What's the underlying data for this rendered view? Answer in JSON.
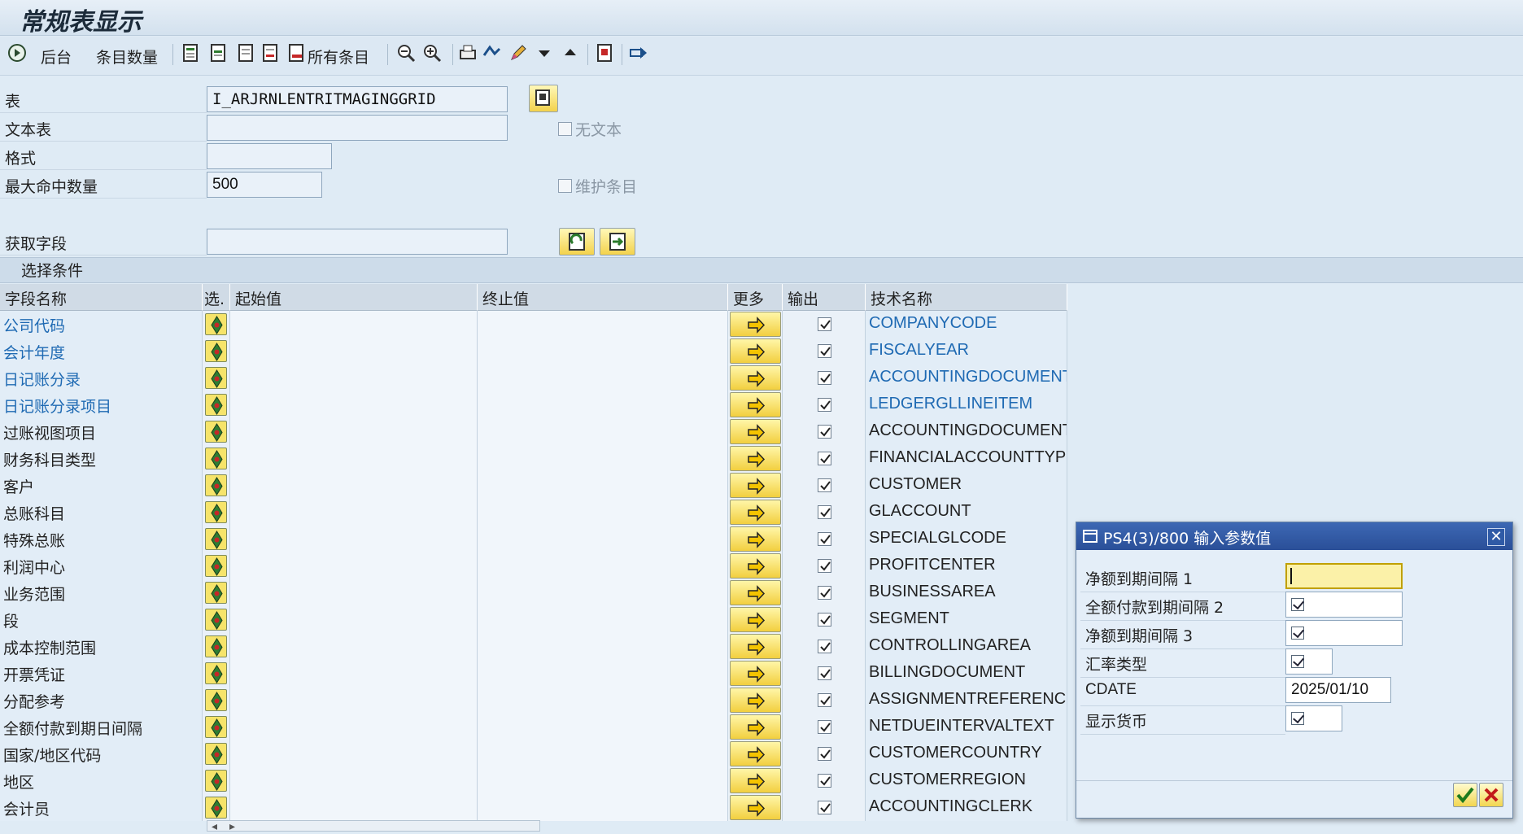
{
  "window": {
    "title": "常规表显示"
  },
  "toolbar": {
    "background_label": "后台",
    "entry_count_label": "条目数量",
    "all_entries_label": "所有条目"
  },
  "header_form": {
    "table": {
      "label": "表",
      "value": "I_ARJRNLENTRITMAGINGGRID"
    },
    "text_table": {
      "label": "文本表",
      "value": ""
    },
    "format": {
      "label": "格式",
      "value": ""
    },
    "max_hits": {
      "label": "最大命中数量",
      "value": "500"
    },
    "fetch_fields": {
      "label": "获取字段",
      "value": ""
    },
    "no_text": {
      "label": "无文本",
      "checked": false
    },
    "maintain_entries": {
      "label": "维护条目",
      "checked": false
    }
  },
  "selection": {
    "title": "选择条件",
    "columns": {
      "field_name": "字段名称",
      "select": "选.",
      "from_value": "起始值",
      "to_value": "终止值",
      "more": "更多",
      "output": "输出",
      "tech_name": "技术名称"
    },
    "rows": [
      {
        "name": "公司代码",
        "tech": "COMPANYCODE",
        "link": true
      },
      {
        "name": "会计年度",
        "tech": "FISCALYEAR",
        "link": true
      },
      {
        "name": "日记账分录",
        "tech": "ACCOUNTINGDOCUMENT",
        "link": true
      },
      {
        "name": "日记账分录项目",
        "tech": "LEDGERGLLINEITEM",
        "link": true
      },
      {
        "name": "过账视图项目",
        "tech": "ACCOUNTINGDOCUMENTI...",
        "link": false
      },
      {
        "name": "财务科目类型",
        "tech": "FINANCIALACCOUNTTYPE",
        "link": false
      },
      {
        "name": "客户",
        "tech": "CUSTOMER",
        "link": false
      },
      {
        "name": "总账科目",
        "tech": "GLACCOUNT",
        "link": false
      },
      {
        "name": "特殊总账",
        "tech": "SPECIALGLCODE",
        "link": false
      },
      {
        "name": "利润中心",
        "tech": "PROFITCENTER",
        "link": false
      },
      {
        "name": "业务范围",
        "tech": "BUSINESSAREA",
        "link": false
      },
      {
        "name": "段",
        "tech": "SEGMENT",
        "link": false
      },
      {
        "name": "成本控制范围",
        "tech": "CONTROLLINGAREA",
        "link": false
      },
      {
        "name": "开票凭证",
        "tech": "BILLINGDOCUMENT",
        "link": false
      },
      {
        "name": "分配参考",
        "tech": "ASSIGNMENTREFERENCE",
        "link": false
      },
      {
        "name": "全额付款到期日间隔",
        "tech": "NETDUEINTERVALTEXT",
        "link": false
      },
      {
        "name": "国家/地区代码",
        "tech": "CUSTOMERCOUNTRY",
        "link": false
      },
      {
        "name": "地区",
        "tech": "CUSTOMERREGION",
        "link": false
      },
      {
        "name": "会计员",
        "tech": "ACCOUNTINGCLERK",
        "link": false
      }
    ]
  },
  "dialog": {
    "title": "PS4(3)/800 输入参数值",
    "fields": [
      {
        "label": "净额到期间隔 1",
        "value": ""
      },
      {
        "label": "全额付款到期间隔 2",
        "checked": true
      },
      {
        "label": "净额到期间隔 3",
        "checked": true
      },
      {
        "label": "汇率类型",
        "checked": true
      },
      {
        "label": "CDATE",
        "value": "2025/01/10"
      },
      {
        "label": "显示货币",
        "checked": true
      }
    ]
  },
  "colors": {
    "accent": "#2a4f98",
    "link": "#1f6ab3",
    "button_yellow": "#f2cf3f"
  }
}
